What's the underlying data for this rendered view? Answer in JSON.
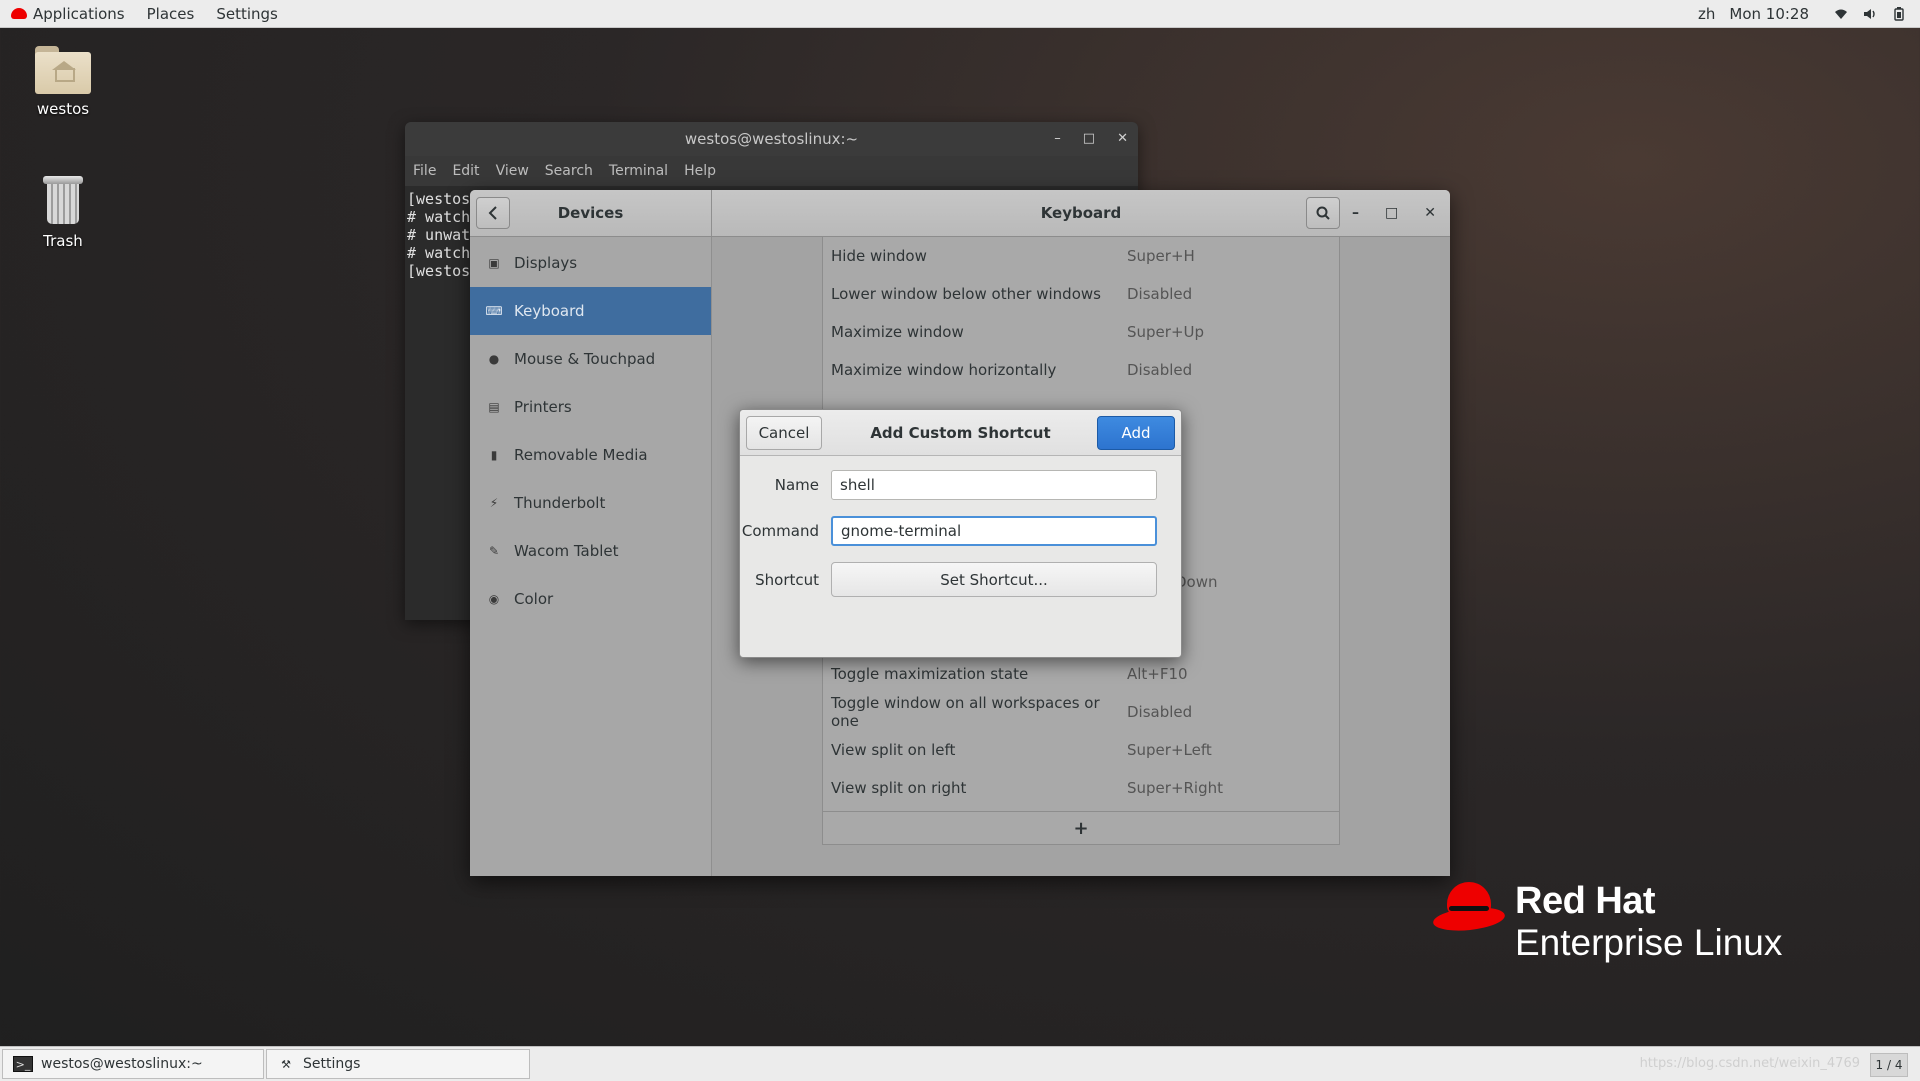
{
  "topbar": {
    "applications": "Applications",
    "places": "Places",
    "settings": "Settings",
    "input_method": "zh",
    "clock": "Mon 10:28",
    "icons": [
      "wifi-icon",
      "volume-icon",
      "battery-icon"
    ]
  },
  "desktop": {
    "home_label": "westos",
    "trash_label": "Trash"
  },
  "terminal": {
    "title": "westos@westoslinux:~",
    "menu": [
      "File",
      "Edit",
      "View",
      "Search",
      "Terminal",
      "Help"
    ],
    "lines": [
      "[westos",
      "# watch",
      "# unwat",
      "# watch",
      "[westos"
    ]
  },
  "settings": {
    "panel_title": "Devices",
    "section_title": "Keyboard",
    "sidebar": [
      {
        "label": "Displays",
        "icon": "display-icon"
      },
      {
        "label": "Keyboard",
        "icon": "keyboard-icon",
        "active": true
      },
      {
        "label": "Mouse & Touchpad",
        "icon": "mouse-icon"
      },
      {
        "label": "Printers",
        "icon": "printer-icon"
      },
      {
        "label": "Removable Media",
        "icon": "usb-icon"
      },
      {
        "label": "Thunderbolt",
        "icon": "thunderbolt-icon"
      },
      {
        "label": "Wacom Tablet",
        "icon": "tablet-icon"
      },
      {
        "label": "Color",
        "icon": "color-icon"
      }
    ],
    "shortcuts_top": [
      {
        "name": "Hide window",
        "shortcut": "Super+H"
      },
      {
        "name": "Lower window below other windows",
        "shortcut": "Disabled"
      },
      {
        "name": "Maximize window",
        "shortcut": "Super+Up"
      },
      {
        "name": "Maximize window horizontally",
        "shortcut": "Disabled"
      }
    ],
    "partial_shortcut": "Down",
    "shortcuts_bottom": [
      {
        "name": "Toggle maximization state",
        "shortcut": "Alt+F10"
      },
      {
        "name": "Toggle window on all workspaces or one",
        "shortcut": "Disabled"
      },
      {
        "name": "View split on left",
        "shortcut": "Super+Left"
      },
      {
        "name": "View split on right",
        "shortcut": "Super+Right"
      }
    ],
    "add_symbol": "+"
  },
  "dialog": {
    "title": "Add Custom Shortcut",
    "cancel": "Cancel",
    "add": "Add",
    "name_label": "Name",
    "name_value": "shell",
    "command_label": "Command",
    "command_value": "gnome-terminal",
    "shortcut_label": "Shortcut",
    "set_shortcut": "Set Shortcut..."
  },
  "logo": {
    "line1": "Red Hat",
    "line2": "Enterprise Linux"
  },
  "taskbar": {
    "tasks": [
      {
        "label": "westos@westoslinux:~",
        "icon": "terminal-icon"
      },
      {
        "label": "Settings",
        "icon": "settings-icon"
      }
    ],
    "workspace": "1 / 4",
    "watermark": "https://blog.csdn.net/weixin_4769"
  },
  "colors": {
    "accent": "#3f6d9f",
    "add_button": "#2d74cf",
    "redhat": "#ee0000"
  }
}
